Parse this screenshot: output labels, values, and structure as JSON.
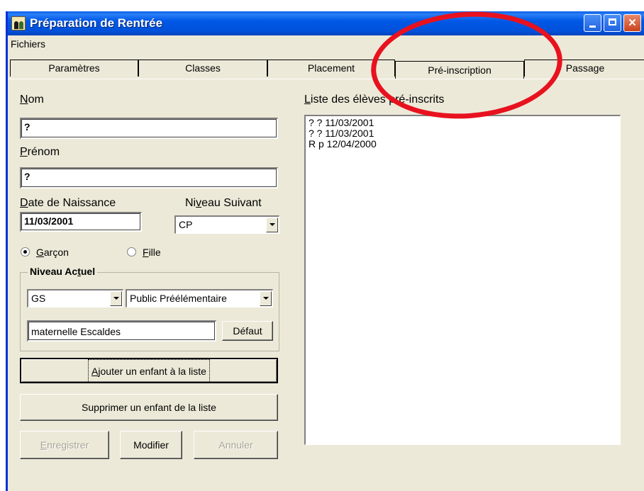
{
  "window": {
    "title": "Préparation de Rentrée"
  },
  "menu": {
    "fichiers": "Fichiers"
  },
  "tabs": [
    {
      "label": "Paramètres"
    },
    {
      "label": "Classes"
    },
    {
      "label": "Placement"
    },
    {
      "label": "Pré-inscription",
      "active": true
    },
    {
      "label": "Passage"
    }
  ],
  "form": {
    "nom_label_first": "N",
    "nom_label_rest": "om",
    "nom_value": "?",
    "prenom_label_first": "P",
    "prenom_label_rest": "rénom",
    "prenom_value": "?",
    "date_label_first": "D",
    "date_label_rest": "ate de Naissance",
    "date_value": "11/03/2001",
    "niveau_suivant_label_pre": "Ni",
    "niveau_suivant_label_u": "v",
    "niveau_suivant_label_post": "eau Suivant",
    "niveau_suivant_value": "CP",
    "garcon_first": "G",
    "garcon_rest": "arçon",
    "garcon_checked": true,
    "fille_first": "F",
    "fille_rest": "ille",
    "fille_checked": false
  },
  "niveau_actuel": {
    "title_pre": "Niveau Ac",
    "title_u": "t",
    "title_post": "uel",
    "niveau_value": "GS",
    "secteur_value": "Public Préélémentaire",
    "ecole_value": "maternelle Escaldes",
    "defaut_label": "Défaut"
  },
  "buttons": {
    "ajouter_first": "A",
    "ajouter_rest": "jouter un enfant à la liste",
    "supprimer": "Supprimer un enfant de la liste",
    "enregistrer_first": "E",
    "enregistrer_rest": "nregistrer",
    "modifier": "Modifier",
    "annuler": "Annuler"
  },
  "list": {
    "label_first": "L",
    "label_rest": "iste des élèves pré-inscrits",
    "items": [
      "? ? 11/03/2001",
      "? ? 11/03/2001",
      "R p 12/04/2000"
    ]
  },
  "colors": {
    "titlebar": "#0058e6",
    "window_bg": "#ece9d8",
    "annotation_circle": "#e8121f"
  },
  "icons": [
    "app-people-icon",
    "minimize-icon",
    "maximize-icon",
    "close-icon",
    "dropdown-arrow-icon",
    "radio-icon"
  ]
}
